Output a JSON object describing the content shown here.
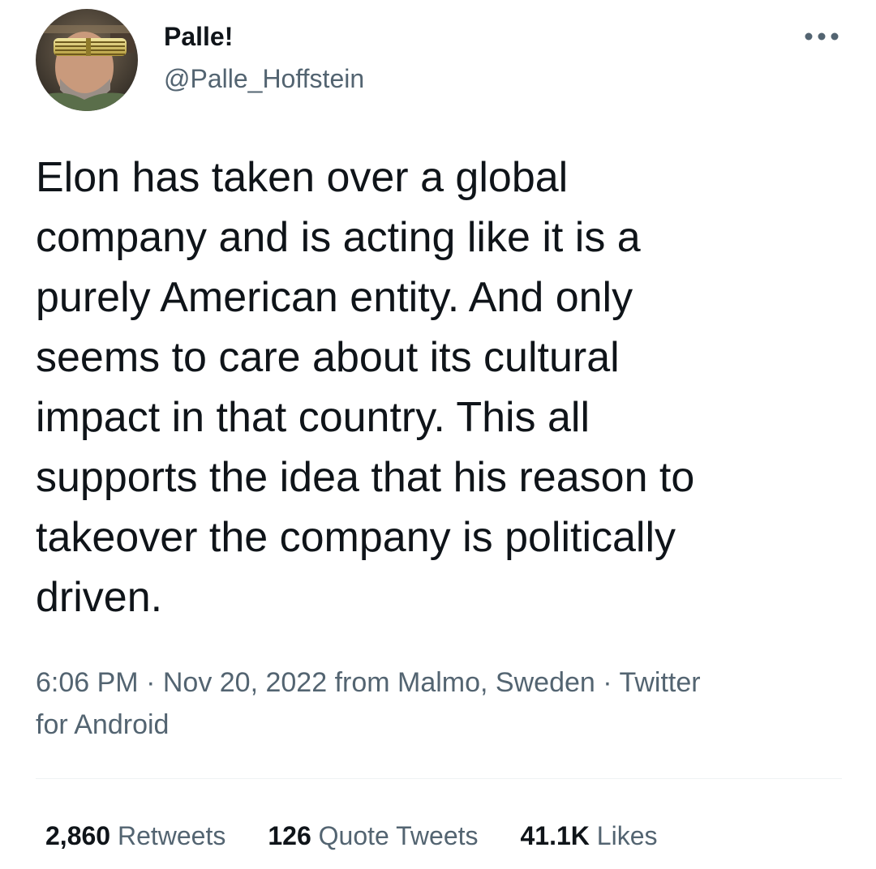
{
  "author": {
    "display_name": "Palle!",
    "handle": "@Palle_Hoffstein",
    "avatar_icon": "avatar-photo"
  },
  "more_icon": "more-horizontal-icon",
  "tweet": {
    "lines": [
      "Elon has taken over a global",
      "company and is acting like it is a",
      "purely American entity. And only",
      "seems to care about its cultural",
      "impact in that country. This all",
      "supports the idea that his reason to",
      "takeover the company is politically",
      "driven."
    ]
  },
  "meta": {
    "time": "6:06 PM",
    "date": "Nov 20, 2022",
    "location_text": "from Malmo, Sweden",
    "source_line1": "Twitter",
    "source_line2": "for Android",
    "separator": "·"
  },
  "stats": {
    "retweets": {
      "count": "2,860",
      "label": "Retweets"
    },
    "quote_tweets": {
      "count": "126",
      "label": "Quote Tweets"
    },
    "likes": {
      "count": "41.1K",
      "label": "Likes"
    }
  },
  "colors": {
    "primary_text": "#0f1419",
    "secondary_text": "#536471",
    "divider": "#eff3f4",
    "background": "#ffffff"
  }
}
